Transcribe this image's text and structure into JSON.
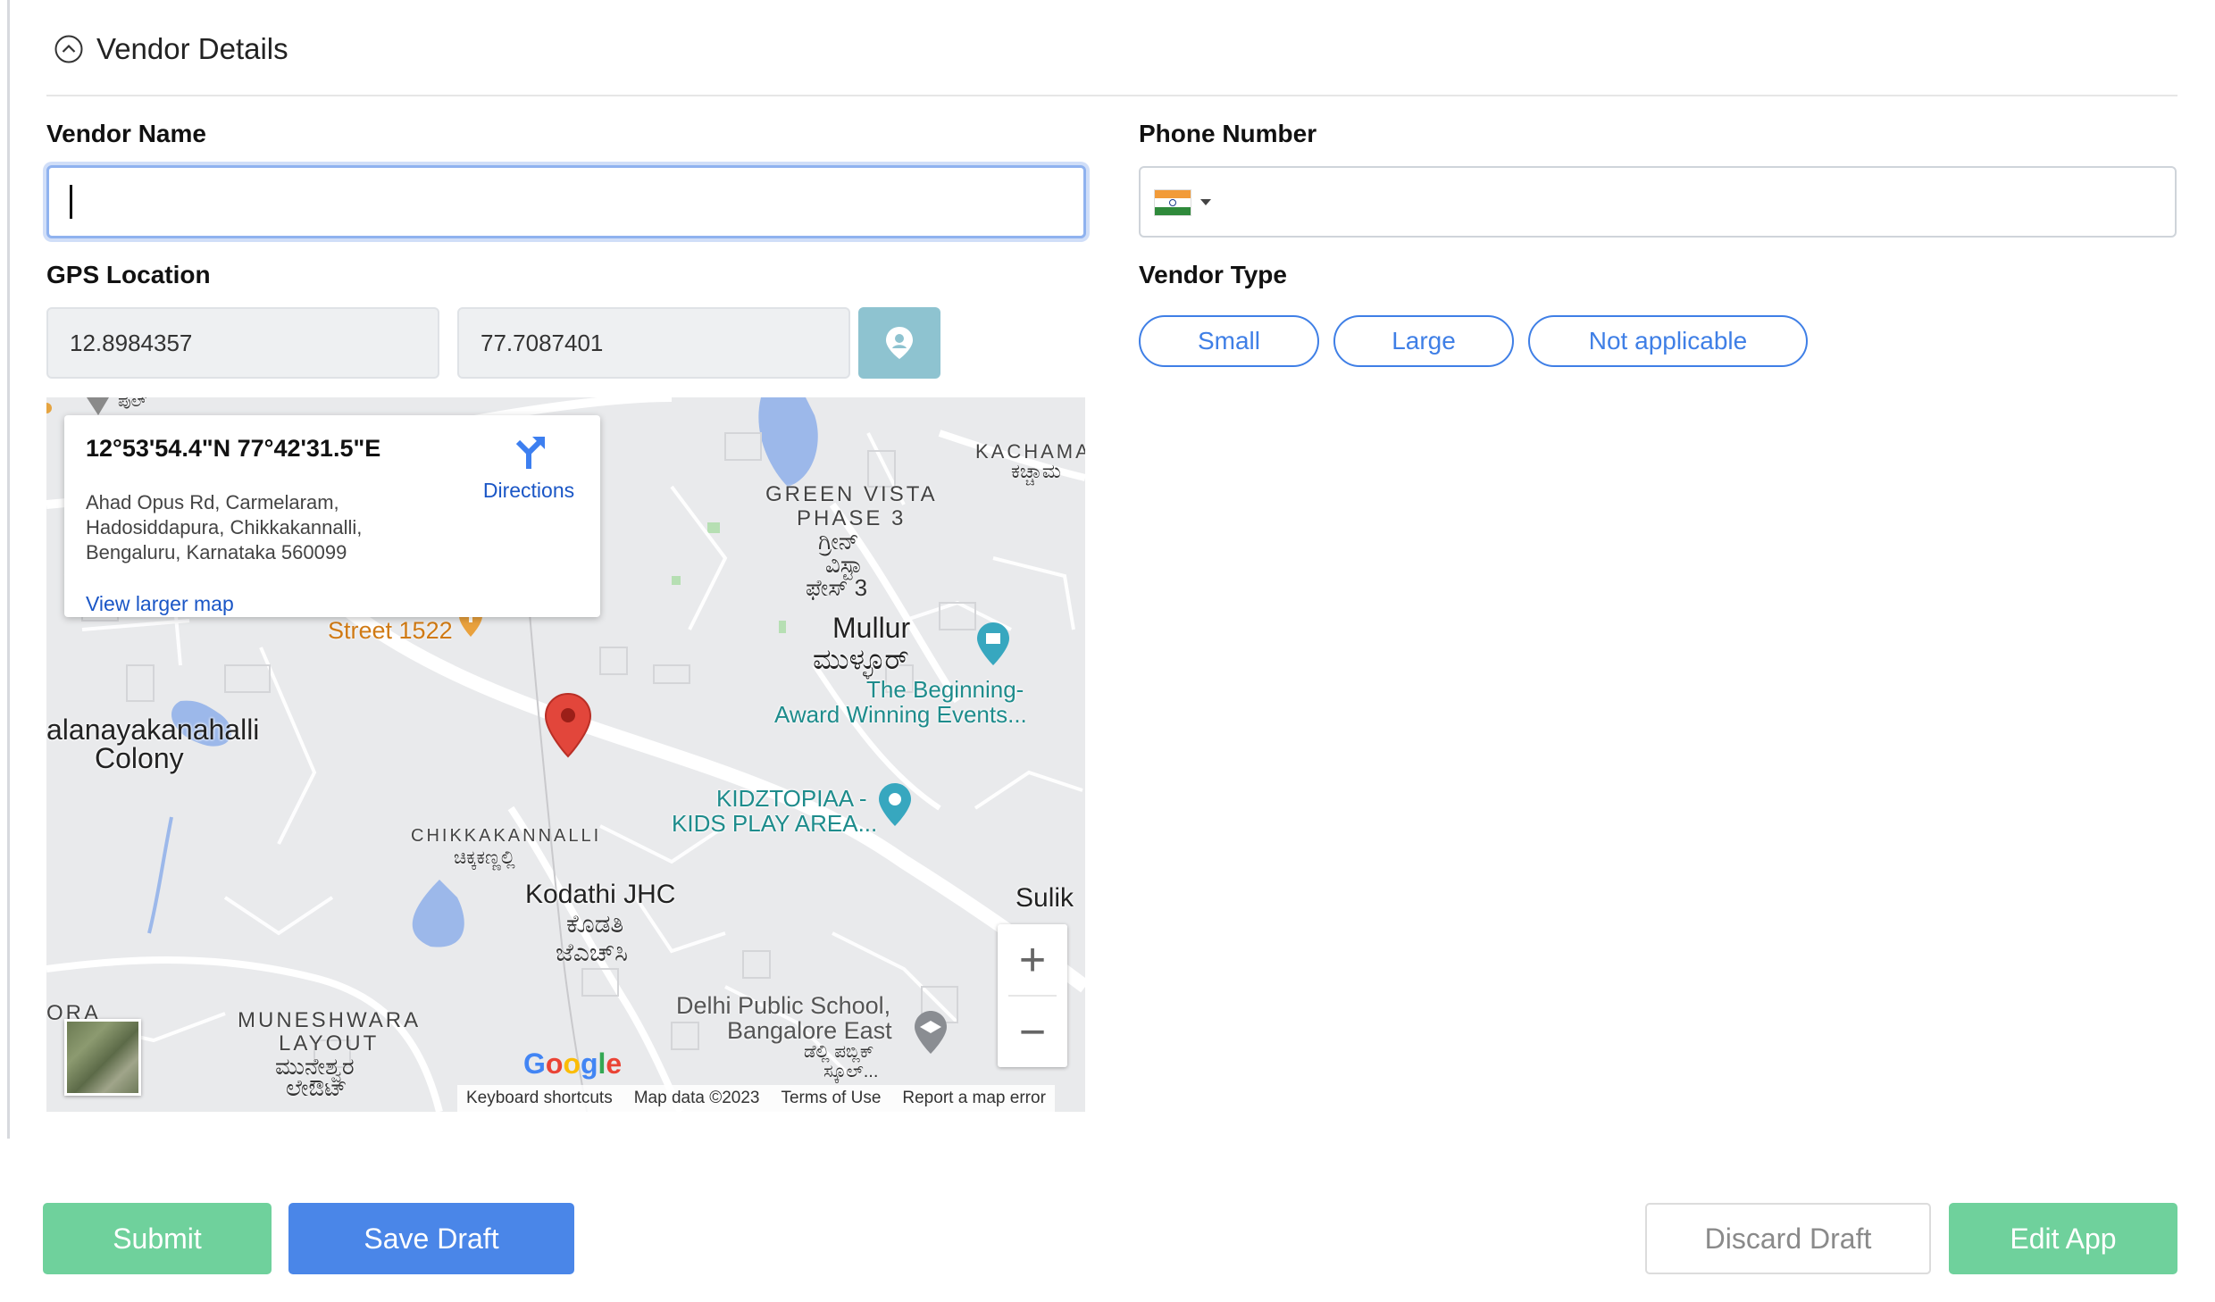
{
  "section": {
    "title": "Vendor Details",
    "icon": "chevron-up-circle-icon"
  },
  "fields": {
    "vendor_name": {
      "label": "Vendor Name",
      "value": ""
    },
    "phone_number": {
      "label": "Phone Number",
      "country": "India",
      "value": ""
    },
    "gps_location": {
      "label": "GPS Location",
      "latitude": "12.8984357",
      "longitude": "77.7087401",
      "locate_icon": "map-pin-icon"
    },
    "vendor_type": {
      "label": "Vendor Type",
      "options": [
        "Small",
        "Large",
        "Not applicable"
      ]
    }
  },
  "map": {
    "info": {
      "coords": "12°53'54.4\"N 77°42'31.5\"E",
      "address_line1": "Ahad Opus Rd, Carmelaram,",
      "address_line2": "Hadosiddapura, Chikkakannalli,",
      "address_line3": "Bengaluru, Karnataka 560099",
      "directions": "Directions",
      "larger_map": "View larger map"
    },
    "labels": {
      "kachamar": "KACHAMAR",
      "kachamar_kn": "ಕಚ್ಚಾಮ",
      "green_vista_1": "GREEN VISTA",
      "green_vista_2": "PHASE 3",
      "green_vista_kn1": "ಗ್ರೀನ್",
      "green_vista_kn2": "ವಿಸ್ಟಾ",
      "green_vista_kn3": "ಫೇಸ್ 3",
      "mullur": "Mullur",
      "mullur_kn": "ಮುಳ್ಳೂರ್",
      "beginning_1": "The Beginning-",
      "beginning_2": "Award Winning Events...",
      "street_1522": "Street 1522",
      "colony_1": "alanayakanahalli",
      "colony_2": "Colony",
      "kidztopia_1": "KIDZTOPIAA -",
      "kidztopia_2": "KIDS PLAY AREA...",
      "chikkakannalli": "CHIKKAKANNALLI",
      "chikkakannalli_kn": "ಚಿಕ್ಕಕಣ್ಣಲ್ಲಿ",
      "kodathi": "Kodathi JHC",
      "kodathi_kn1": "ಕೊಡತಿ",
      "kodathi_kn2": "ಜೆಎಚ್‌ಸಿ",
      "suliku": "Sulik",
      "muneshwara_1": "MUNESHWARA",
      "muneshwara_2": "LAYOUT",
      "muneshwara_kn1": "ಮುನೇಶ್ವರ",
      "muneshwara_kn2": "ಲೇಔಟ್",
      "dps_1": "Delhi Public School,",
      "dps_2": "Bangalore East",
      "dps_kn1": "ಡೆಲ್ಲಿ ಪಬ್ಲಿಕ್",
      "dps_kn2": "ಸ್ಕೂಲ್...",
      "ora": "ORA",
      "top_kn": "ಪುಲ್"
    },
    "google": "Google",
    "attribution": [
      "Keyboard shortcuts",
      "Map data ©2023",
      "Terms of Use",
      "Report a map error"
    ],
    "zoom_in": "+",
    "zoom_out": "−"
  },
  "actions": {
    "submit": "Submit",
    "save_draft": "Save Draft",
    "discard_draft": "Discard Draft",
    "edit_app": "Edit App"
  },
  "colors": {
    "primary_blue": "#4a86e8",
    "green": "#6fd19c",
    "chip_blue": "#3f7fe6",
    "locate_button": "#8ec3d0"
  }
}
